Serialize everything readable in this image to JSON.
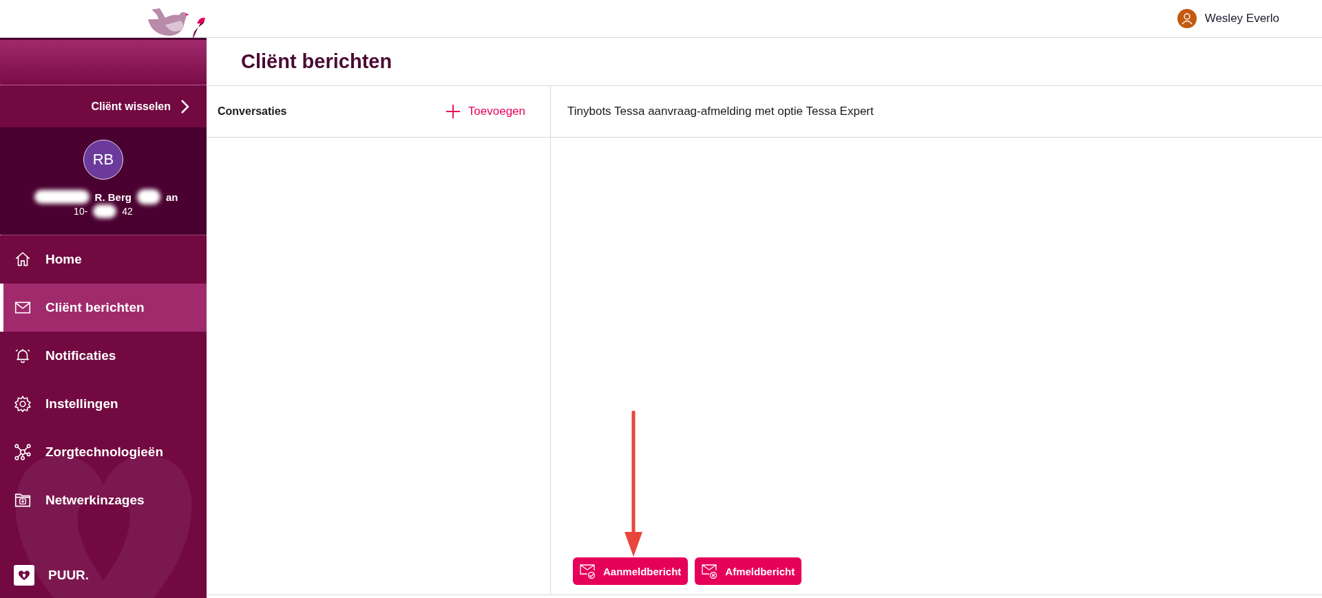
{
  "header": {
    "user_name": "Wesley Everlo"
  },
  "sidebar": {
    "switch_client": "Cliënt wisselen",
    "client": {
      "initials": "RB",
      "name_parts": [
        "R. Berg",
        "an"
      ],
      "birthdate_parts": [
        "10-",
        "42"
      ]
    },
    "items": [
      {
        "label": "Home",
        "selected": false
      },
      {
        "label": "Cliënt berichten",
        "selected": true
      },
      {
        "label": "Notificaties",
        "selected": false
      },
      {
        "label": "Instellingen",
        "selected": false
      },
      {
        "label": "Zorgtechnologieën",
        "selected": false
      },
      {
        "label": "Netwerkinzages",
        "selected": false
      }
    ],
    "footer": "PUUR."
  },
  "page_title": "Cliënt berichten",
  "conversations": {
    "title": "Conversaties",
    "add_button": "Toevoegen"
  },
  "conversation": {
    "title": "Tinybots Tessa aanvraag-afmelding met optie Tessa Expert",
    "buttons": [
      {
        "label": "Aanmeldbericht",
        "kind": "check"
      },
      {
        "label": "Afmeldbericht",
        "kind": "cross"
      }
    ]
  }
}
